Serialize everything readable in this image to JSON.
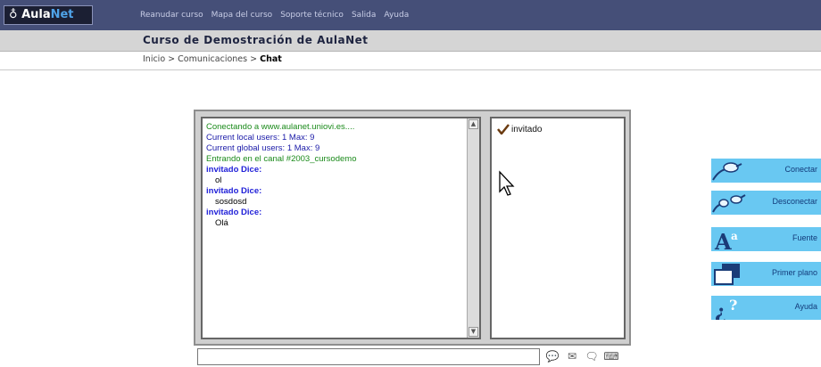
{
  "header": {
    "logo_text_a": "Aula",
    "logo_text_b": "Net",
    "nav": [
      "Reanudar curso",
      "Mapa del curso",
      "Soporte técnico",
      "Salida",
      "Ayuda"
    ]
  },
  "course": {
    "title": "Curso de Demostración de AulaNet"
  },
  "breadcrumb": {
    "home": "Inicio",
    "section": "Comunicaciones",
    "current": "Chat",
    "sep": ">"
  },
  "chat": {
    "messages": [
      {
        "kind": "sys",
        "text": "Conectando a www.aulanet.uniovi.es...."
      },
      {
        "kind": "info",
        "text": "Current local users: 1 Max: 9"
      },
      {
        "kind": "info",
        "text": "Current global users: 1 Max: 9"
      },
      {
        "kind": "sys",
        "text": "Entrando en el canal #2003_cursodemo"
      },
      {
        "kind": "who",
        "text": "invitado Dice:"
      },
      {
        "kind": "txt",
        "text": "ol"
      },
      {
        "kind": "who",
        "text": "invitado Dice:"
      },
      {
        "kind": "txt",
        "text": "sosdosd"
      },
      {
        "kind": "who",
        "text": "invitado Dice:"
      },
      {
        "kind": "txt",
        "text": "Olá"
      }
    ],
    "users": [
      "invitado"
    ],
    "input_value": ""
  },
  "actions": [
    {
      "label": "Conectar",
      "icon": "connect-icon"
    },
    {
      "label": "Desconectar",
      "icon": "disconnect-icon"
    },
    {
      "label": "Fuente",
      "icon": "font-icon"
    },
    {
      "label": "Primer plano",
      "icon": "foreground-icon"
    },
    {
      "label": "Ayuda",
      "icon": "help-icon"
    }
  ]
}
